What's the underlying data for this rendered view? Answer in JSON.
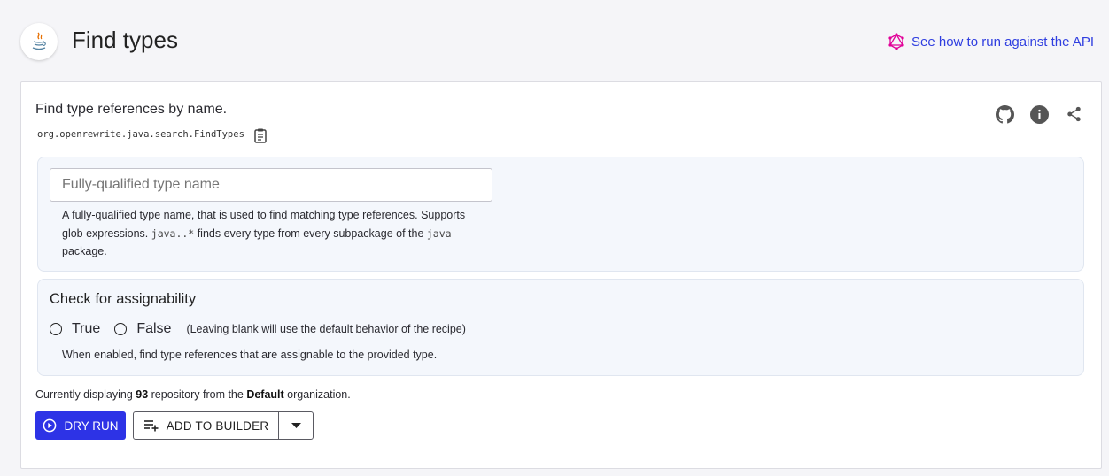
{
  "header": {
    "title": "Find types",
    "logo_icon": "java-logo-icon",
    "api_link_label": "See how to run against the API",
    "api_link_icon": "graphql-icon",
    "api_link_color": "#2f3ee0"
  },
  "recipe": {
    "description": "Find type references by name.",
    "id": "org.openrewrite.java.search.FindTypes",
    "icons": [
      "github-icon",
      "info-icon",
      "share-icon"
    ]
  },
  "options": {
    "type_name": {
      "placeholder": "Fully-qualified type name",
      "value": "",
      "help_prefix": "A fully-qualified type name, that is used to find matching type references. Supports glob expressions. ",
      "help_code1": "java..*",
      "help_middle": " finds every type from every subpackage of the ",
      "help_code2": "java",
      "help_suffix": " package."
    },
    "assignability": {
      "title": "Check for assignability",
      "true_label": "True",
      "false_label": "False",
      "hint": "(Leaving blank will use the default behavior of the recipe)",
      "help": "When enabled, find type references that are assignable to the provided type."
    }
  },
  "status": {
    "prefix": "Currently displaying ",
    "count": "93",
    "middle": " repository from the ",
    "org": "Default",
    "suffix": " organization."
  },
  "actions": {
    "dry_run_label": "DRY RUN",
    "add_to_builder_label": "ADD TO BUILDER",
    "primary_color": "#2d33e6"
  }
}
